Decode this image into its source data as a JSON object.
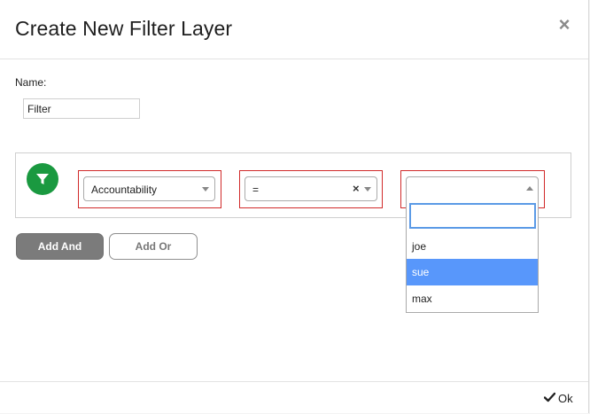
{
  "dialog": {
    "title": "Create New Filter Layer",
    "close_glyph": "×"
  },
  "name_field": {
    "label": "Name:",
    "value": "Filter"
  },
  "filter_row": {
    "field_select": "Accountability",
    "operator_select": "=",
    "operator_clear_glyph": "×",
    "value_select": "",
    "value_dropdown": {
      "search_value": "",
      "options": [
        "joe",
        "sue",
        "max"
      ],
      "highlighted_option": "sue"
    }
  },
  "buttons": {
    "add_and": "Add And",
    "add_or": "Add Or"
  },
  "footer": {
    "ok_label": "Ok"
  },
  "colors": {
    "filter_icon_bg": "#1a9940",
    "highlight_border": "#d12a2a",
    "option_highlight": "#5897fb",
    "add_and_bg": "#7b7b7b"
  },
  "icons": {
    "filter": "funnel-icon",
    "close": "close-icon",
    "ok": "check-icon"
  }
}
